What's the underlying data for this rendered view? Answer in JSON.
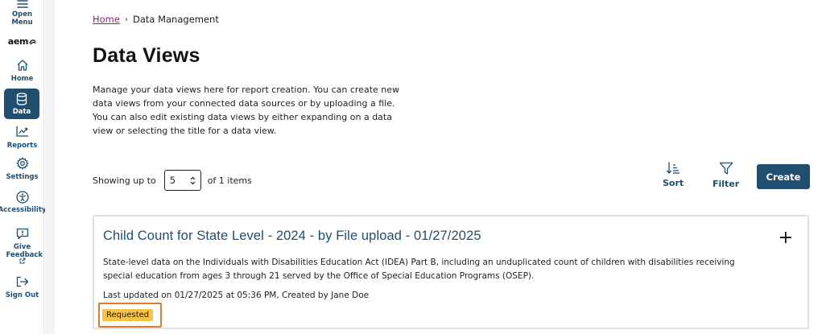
{
  "sidebar": {
    "open_menu": "Open Menu",
    "logo": "aem",
    "items": [
      {
        "label": "Home",
        "icon": "home-icon"
      },
      {
        "label": "Data",
        "icon": "database-icon",
        "active": true
      },
      {
        "label": "Reports",
        "icon": "chart-icon"
      },
      {
        "label": "Settings",
        "icon": "gear-icon"
      },
      {
        "label": "Accessibility",
        "icon": "accessibility-icon"
      },
      {
        "label": "Give Feedback",
        "icon": "feedback-icon"
      },
      {
        "label": "Sign Out",
        "icon": "sign-out-icon"
      }
    ]
  },
  "breadcrumb": {
    "home": "Home",
    "current": "Data Management"
  },
  "page": {
    "title": "Data Views",
    "description": "Manage your data views here for report creation. You can create new data views from your connected data sources or by uploading a file. You can also edit existing data views by either expanding on a data view or selecting the title for a data view."
  },
  "pagination": {
    "prefix": "Showing up to",
    "value": "5",
    "suffix": "of 1 items"
  },
  "toolbar": {
    "sort": "Sort",
    "filter": "Filter",
    "create": "Create"
  },
  "card": {
    "title": "Child Count for State Level - 2024 - by File upload - 01/27/2025",
    "description": "State-level data on the Individuals with Disabilities Education Act (IDEA) Part B, including an unduplicated count of children with disabilities receiving special education from ages 3 through 21 served by the Office of Special Education Programs (OSEP).",
    "updated": "Last updated on 01/27/2025 at 05:36 PM, Created by Jane Doe",
    "status": "Requested",
    "expand_symbol": "+"
  },
  "colors": {
    "brand": "#1f4e6e",
    "link": "#7b2e63",
    "badge": "#f5c345",
    "highlight": "#e07a2b"
  }
}
